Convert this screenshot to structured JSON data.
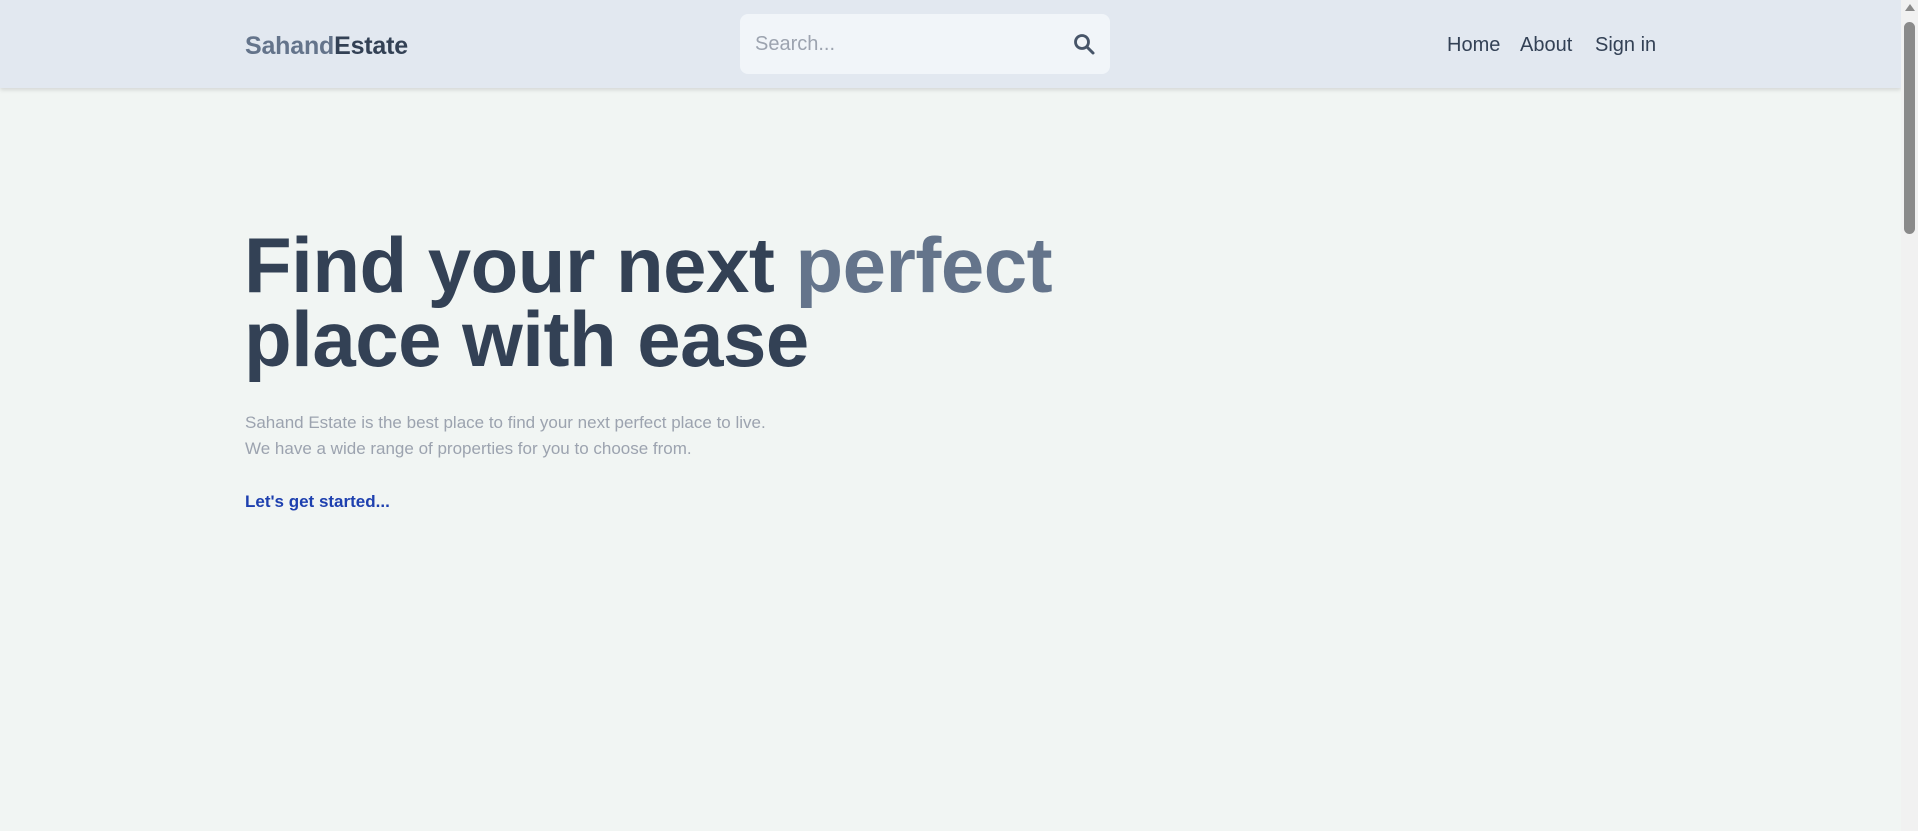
{
  "header": {
    "brand_part1": "Sahand",
    "brand_part2": "Estate",
    "search_placeholder": "Search...",
    "search_icon": "search-icon",
    "nav": [
      "Home",
      "About",
      "Sign in"
    ]
  },
  "hero": {
    "title_main1": "Find your next ",
    "title_accent": "perfect",
    "title_main2": "place with ease",
    "desc_line1": "Sahand Estate is the best place to find your next perfect place to live.",
    "desc_line2": "We have a wide range of properties for you to choose from.",
    "cta": "Let's get started..."
  },
  "colors": {
    "header_bg": "#e2e8f0",
    "page_bg": "#f1f5f3",
    "text_dark": "#334155",
    "text_muted": "#64748b",
    "link": "#1e40af"
  }
}
